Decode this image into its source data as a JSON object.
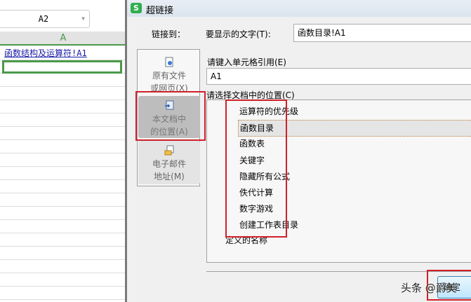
{
  "sheet": {
    "name_box": "A2",
    "column_header": "A",
    "cell_a1": "函数结构及运算符!A1"
  },
  "dialog": {
    "title": "超链接",
    "logo": "S",
    "link_to_label": "链接到：",
    "display_text_label": "要显示的文字(T):",
    "display_text_value": "函数目录!A1",
    "link_types": [
      {
        "line1": "原有文件",
        "line2": "或网页(X)",
        "icon": "file-web-icon"
      },
      {
        "line1": "本文档中",
        "line2": "的位置(A)",
        "icon": "document-place-icon",
        "selected": true
      },
      {
        "line1": "电子邮件",
        "line2": "地址(M)",
        "icon": "email-icon"
      }
    ],
    "cell_ref_label": "请键入单元格引用(E)",
    "cell_ref_value": "A1",
    "location_label": "请选择文档中的位置(C)",
    "locations": [
      "运算符的优先级",
      "函数目录",
      "函数表",
      "关键字",
      "隐藏所有公式",
      "佚代计算",
      "数字游戏",
      "创建工作表目录"
    ],
    "selected_location": "函数目录",
    "defined_names": "定义的名称",
    "ok_label": "确定"
  },
  "watermark": "头条 @爵美",
  "colors": {
    "highlight": "#d0202a",
    "selection_green": "#4a9a4a",
    "link_blue": "#1a1aa6"
  }
}
